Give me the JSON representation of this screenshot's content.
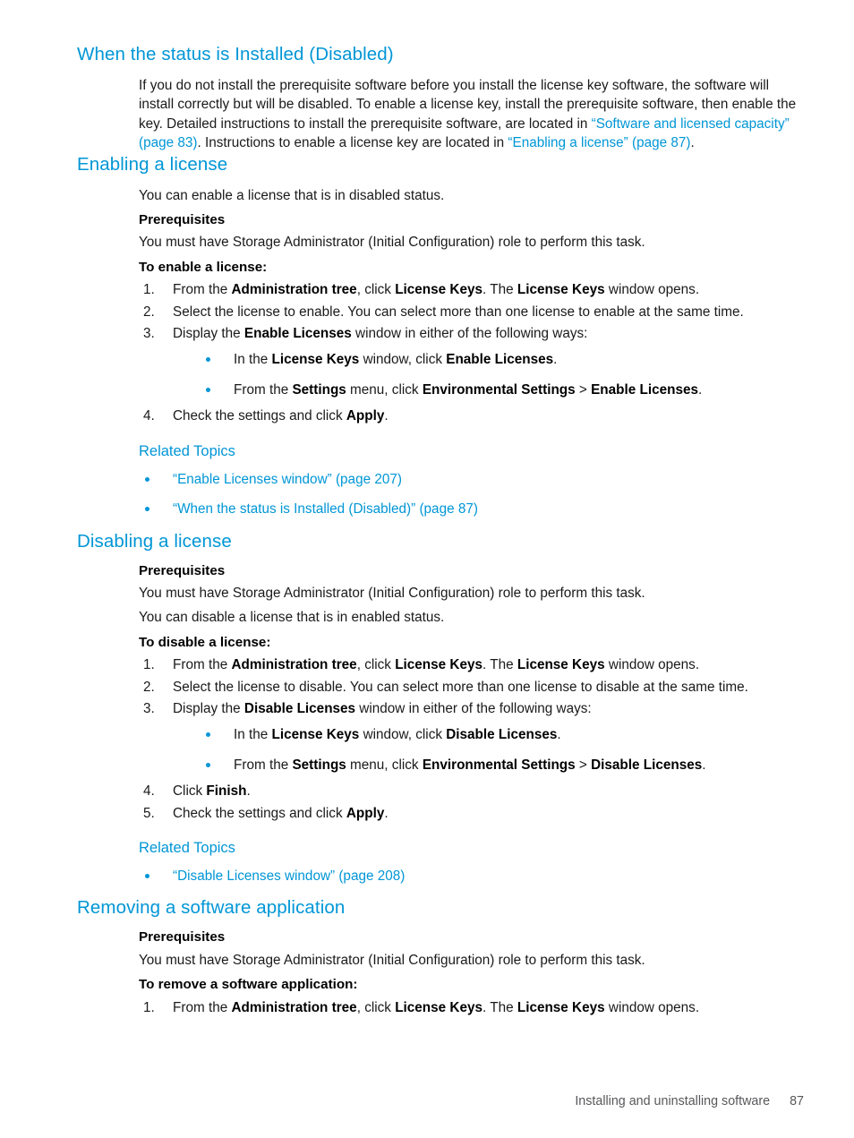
{
  "document": {
    "footer": {
      "chapter": "Installing and uninstalling software",
      "page_number": "87"
    },
    "colors": {
      "heading_blue": "#0096d6",
      "link_blue": "#0096d6",
      "body_text": "#1a1a1a",
      "footer_text": "#58585b"
    }
  },
  "sections": {
    "installed_disabled": {
      "heading": "When the status is Installed (Disabled)",
      "paragraph": {
        "part1": "If you do not install the prerequisite software before you install the license key software, the software will install correctly but will be disabled. To enable a license key, install the prerequisite software, then enable the key. Detailed instructions to install the prerequisite software, are located in ",
        "link1": "“Software and licensed capacity” (page 83)",
        "part2": ". Instructions to enable a license key are located in ",
        "link2": "“Enabling a license” (page 87)",
        "part3": "."
      }
    },
    "enabling_license": {
      "heading": "Enabling a license",
      "intro": "You can enable a license that is in disabled status.",
      "prerequisites_label": "Prerequisites",
      "prerequisites_text": "You must have Storage Administrator (Initial Configuration) role to perform this task.",
      "task_label": "To enable a license:",
      "steps": [
        {
          "num": "1.",
          "seg": [
            "From the ",
            "Administration tree",
            ", click ",
            "License Keys",
            ". The ",
            "License Keys",
            " window opens."
          ]
        },
        {
          "num": "2.",
          "seg": [
            "Select the license to enable. You can select more than one license to enable at the same time."
          ]
        },
        {
          "num": "3.",
          "seg": [
            "Display the ",
            "Enable Licenses",
            " window in either of the following ways:"
          ]
        },
        {
          "num": "4.",
          "seg": [
            "Check the settings and click ",
            "Apply",
            "."
          ]
        }
      ],
      "substeps": [
        {
          "seg": [
            "In the ",
            "License Keys",
            " window, click ",
            "Enable Licenses",
            "."
          ]
        },
        {
          "seg": [
            "From the ",
            "Settings",
            " menu, click ",
            "Environmental Settings",
            " > ",
            "Enable Licenses",
            "."
          ]
        }
      ],
      "related": {
        "heading": "Related Topics",
        "items": [
          "“Enable Licenses window” (page 207)",
          "“When the status is Installed (Disabled)” (page 87)"
        ]
      }
    },
    "disabling_license": {
      "heading": "Disabling a license",
      "prerequisites_label": "Prerequisites",
      "prerequisites_text": "You must have Storage Administrator (Initial Configuration) role to perform this task.",
      "intro": "You can disable a license that is in enabled status.",
      "task_label": "To disable a license:",
      "steps": [
        {
          "num": "1.",
          "seg": [
            "From the ",
            "Administration tree",
            ", click ",
            "License Keys",
            ". The ",
            "License Keys",
            " window opens."
          ]
        },
        {
          "num": "2.",
          "seg": [
            "Select the license to disable. You can select more than one license to disable at the same time."
          ]
        },
        {
          "num": "3.",
          "seg": [
            "Display the ",
            "Disable Licenses",
            " window in either of the following ways:"
          ]
        },
        {
          "num": "4.",
          "seg": [
            "Click ",
            "Finish",
            "."
          ]
        },
        {
          "num": "5.",
          "seg": [
            "Check the settings and click ",
            "Apply",
            "."
          ]
        }
      ],
      "substeps": [
        {
          "seg": [
            "In the ",
            "License Keys",
            " window, click ",
            "Disable Licenses",
            "."
          ]
        },
        {
          "seg": [
            "From the ",
            "Settings",
            " menu, click ",
            "Environmental Settings",
            " > ",
            "Disable Licenses",
            "."
          ]
        }
      ],
      "related": {
        "heading": "Related Topics",
        "items": [
          "“Disable Licenses window” (page 208)"
        ]
      }
    },
    "removing_app": {
      "heading": "Removing a software application",
      "prerequisites_label": "Prerequisites",
      "prerequisites_text": "You must have Storage Administrator (Initial Configuration) role to perform this task.",
      "task_label": "To remove a software application:",
      "steps": [
        {
          "num": "1.",
          "seg": [
            "From the ",
            "Administration tree",
            ", click ",
            "License Keys",
            ". The ",
            "License Keys",
            " window opens."
          ]
        }
      ]
    }
  }
}
